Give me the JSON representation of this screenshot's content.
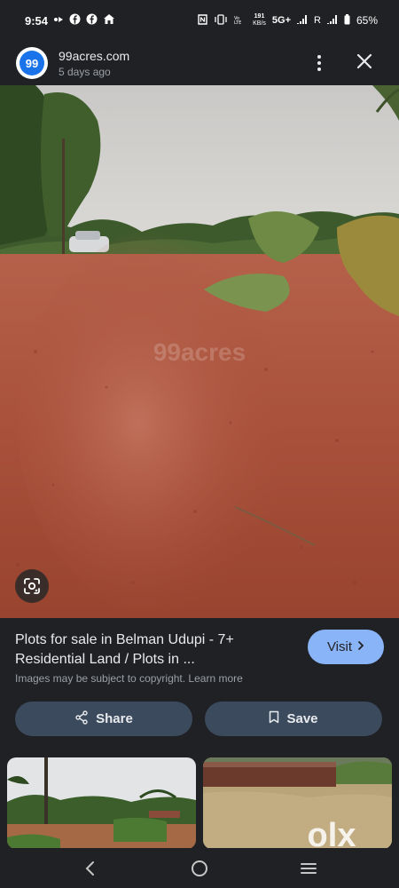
{
  "status_bar": {
    "time": "9:54",
    "net_speed_value": "191",
    "net_speed_unit": "KB/s",
    "network": "5G+",
    "carrier_r": "R",
    "battery": "65%"
  },
  "header": {
    "site_logo_text": "99",
    "site_name": "99acres.com",
    "posted": "5 days ago"
  },
  "image": {
    "watermark": "99acres"
  },
  "result": {
    "title": "Plots for sale in Belman Udupi - 7+ Residential Land / Plots in ...",
    "copyright": "Images may be subject to copyright. Learn more",
    "visit_label": "Visit"
  },
  "actions": {
    "share_label": "Share",
    "save_label": "Save"
  },
  "thumbnails": {
    "watermark": "olx"
  },
  "colors": {
    "background": "#202124",
    "accent": "#8ab4f8",
    "button_bg": "#3c4a5e",
    "logo_blue": "#1a73e8"
  }
}
